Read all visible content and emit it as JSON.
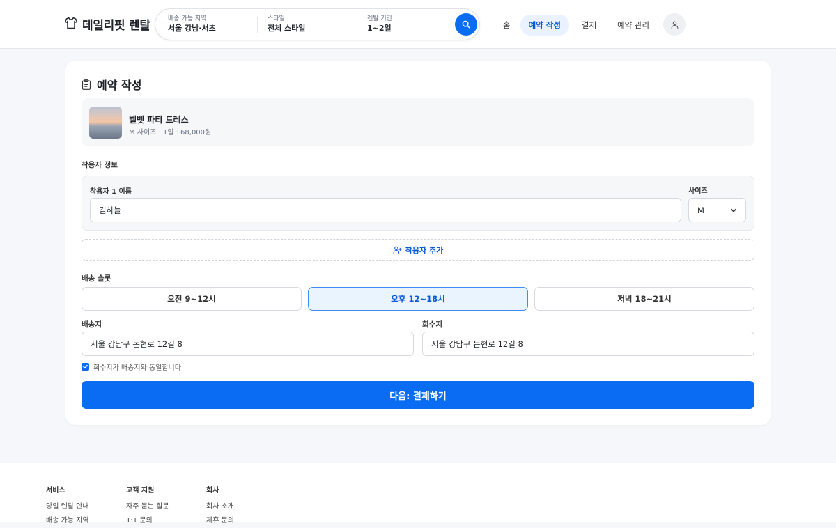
{
  "header": {
    "logo": "데일리핏 렌탈",
    "search": {
      "region": {
        "label": "배송 가능 지역",
        "value": "서울 강남·서초"
      },
      "style": {
        "label": "스타일",
        "value": "전체 스타일"
      },
      "period": {
        "label": "렌탈 기간",
        "value": "1~2일"
      }
    },
    "nav": [
      {
        "label": "홈",
        "active": false
      },
      {
        "label": "예약 작성",
        "active": true
      },
      {
        "label": "결제",
        "active": false
      },
      {
        "label": "예약 관리",
        "active": false
      }
    ]
  },
  "reservation": {
    "title": "예약 작성",
    "product": {
      "name": "벨벳 파티 드레스",
      "meta": "M 사이즈 · 1일 · 68,000원"
    },
    "wearer_section": "착용자 정보",
    "wearer": {
      "name_label": "착용자 1 이름",
      "name_value": "김하늘",
      "size_label": "사이즈",
      "size_value": "M"
    },
    "add_wearer": "착용자 추가",
    "slot_section": "배송 슬롯",
    "slots": [
      {
        "label": "오전 9~12시",
        "selected": false
      },
      {
        "label": "오후 12~18시",
        "selected": true
      },
      {
        "label": "저녁 18~21시",
        "selected": false
      }
    ],
    "delivery": {
      "label": "배송지",
      "value": "서울 강남구 논현로 12길 8"
    },
    "pickup": {
      "label": "회수지",
      "value": "서울 강남구 논현로 12길 8"
    },
    "same_address": {
      "label": "회수지가 배송지와 동일합니다",
      "checked": true
    },
    "next_button": "다음: 결제하기"
  },
  "footer": {
    "columns": [
      {
        "heading": "서비스",
        "links": [
          "당일 렌탈 안내",
          "배송 가능 지역"
        ]
      },
      {
        "heading": "고객 지원",
        "links": [
          "자주 묻는 질문",
          "1:1 문의"
        ]
      },
      {
        "heading": "회사",
        "links": [
          "회사 소개",
          "제휴 문의"
        ]
      }
    ]
  },
  "colors": {
    "accent": "#0a6cf2",
    "accent_light": "#eaf4ff",
    "background": "#f5f7fa"
  },
  "icons": [
    "shirt-icon",
    "search-icon",
    "user-icon",
    "clipboard-icon",
    "user-plus-icon",
    "chevron-down-icon",
    "check-icon"
  ]
}
